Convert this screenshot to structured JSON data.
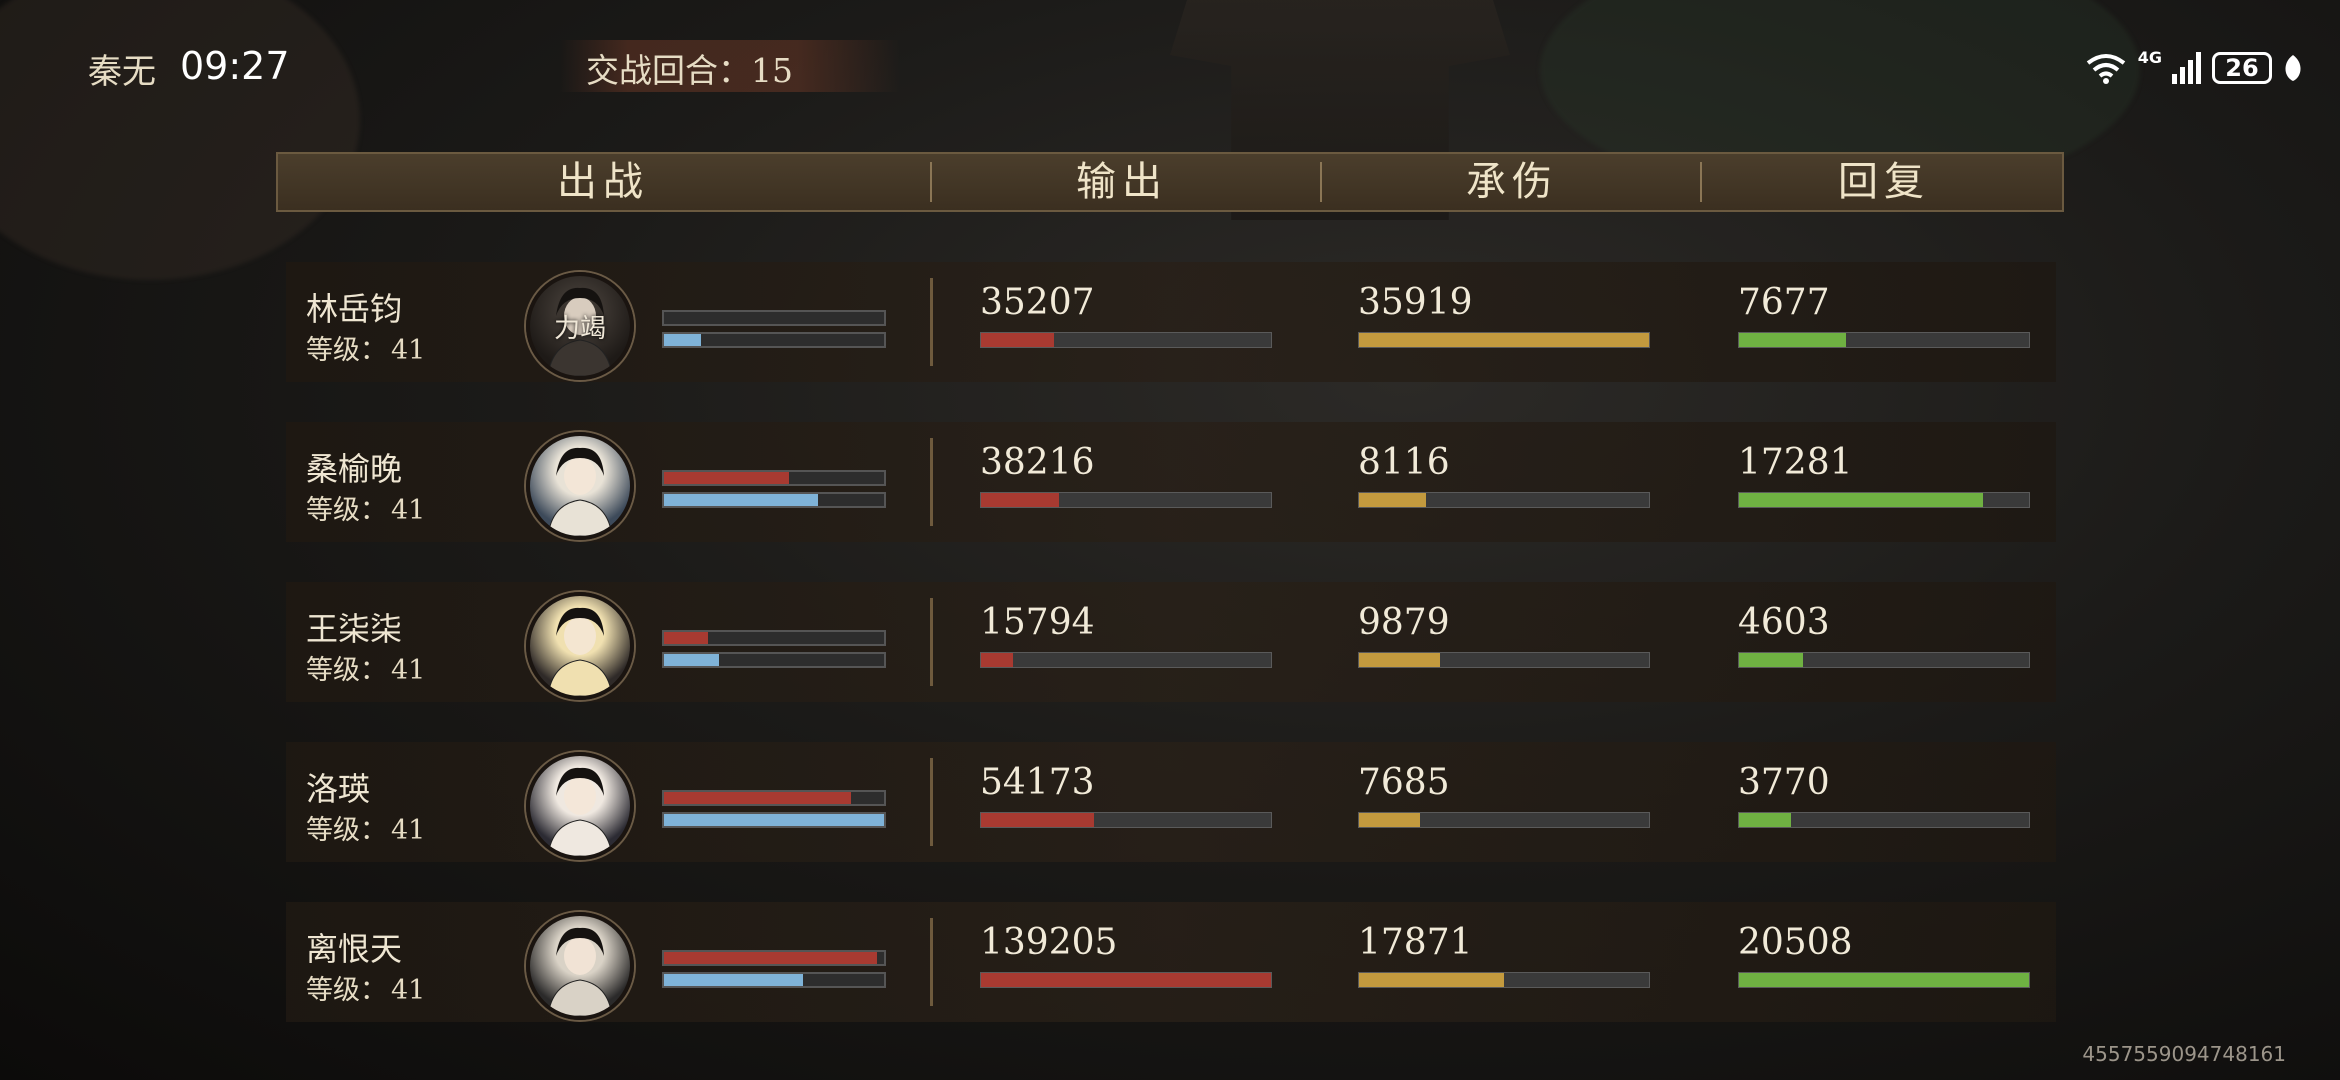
{
  "status": {
    "player_name": "秦无",
    "time": "09:27",
    "round_label": "交战回合：15",
    "battery": "26",
    "network": "4G"
  },
  "headers": [
    "出战",
    "输出",
    "承伤",
    "回复"
  ],
  "colors": {
    "damage": "#a83a31",
    "tank": "#c39a3e",
    "heal": "#6fb142",
    "hp": "#7fb3d8",
    "hp_red": "#a83a31"
  },
  "characters": [
    {
      "name": "林岳钧",
      "level_label": "等级：",
      "level": "41",
      "avatar": "ink-warrior-portrait",
      "avatar_text": "力竭",
      "hp_fraction": 0.0,
      "mp_fraction": 0.17,
      "output": "35207",
      "output_frac": 0.25,
      "taken": "35919",
      "taken_frac": 1.0,
      "heal": "7677",
      "heal_frac": 0.37
    },
    {
      "name": "桑榆晚",
      "level_label": "等级：",
      "level": "41",
      "avatar": "lady-blue-portrait",
      "hp_fraction": 0.57,
      "mp_fraction": 0.7,
      "output": "38216",
      "output_frac": 0.27,
      "taken": "8116",
      "taken_frac": 0.23,
      "heal": "17281",
      "heal_frac": 0.84
    },
    {
      "name": "王柒柒",
      "level_label": "等级：",
      "level": "41",
      "avatar": "lady-yellow-portrait",
      "hp_fraction": 0.2,
      "mp_fraction": 0.25,
      "output": "15794",
      "output_frac": 0.11,
      "taken": "9879",
      "taken_frac": 0.28,
      "heal": "4603",
      "heal_frac": 0.22
    },
    {
      "name": "洛瑛",
      "level_label": "等级：",
      "level": "41",
      "avatar": "lady-pink-portrait",
      "hp_fraction": 0.85,
      "mp_fraction": 1.0,
      "output": "54173",
      "output_frac": 0.39,
      "taken": "7685",
      "taken_frac": 0.21,
      "heal": "3770",
      "heal_frac": 0.18
    },
    {
      "name": "离恨天",
      "level_label": "等级：",
      "level": "41",
      "avatar": "young-man-portrait",
      "hp_fraction": 0.97,
      "mp_fraction": 0.63,
      "output": "139205",
      "output_frac": 1.0,
      "taken": "17871",
      "taken_frac": 0.5,
      "heal": "20508",
      "heal_frac": 1.0
    }
  ],
  "watermark": "4557559094748161"
}
